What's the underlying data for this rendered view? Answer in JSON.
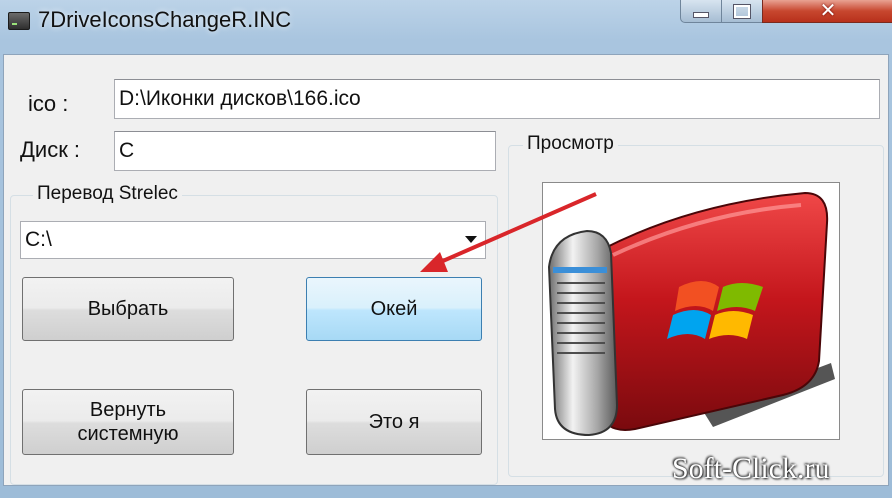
{
  "window": {
    "title": "7DriveIconsChangeR.INC",
    "close_glyph": "✕"
  },
  "form": {
    "ico_label": "ico :",
    "ico_value": "D:\\Иконки дисков\\166.ico",
    "disk_label": "Диск :",
    "disk_value": "C",
    "translation_group": "Перевод Strelec",
    "drive_combo_value": "C:\\",
    "preview_group": "Просмотр"
  },
  "buttons": {
    "choose": "Выбрать",
    "ok": "Окей",
    "restore_line1": "Вернуть",
    "restore_line2": "системную",
    "about": "Это я"
  },
  "watermark": "Soft-Click.ru",
  "colors": {
    "annotation_arrow": "#d9262a",
    "drive_body": "#c4161c"
  }
}
